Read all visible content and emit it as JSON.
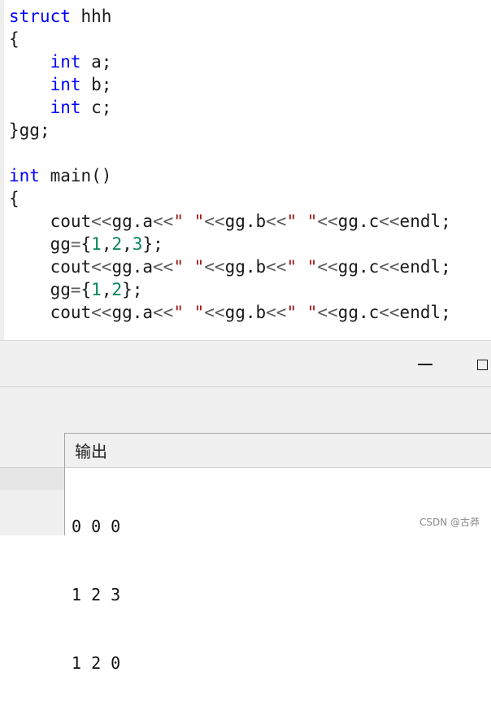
{
  "code": {
    "lines": [
      [
        {
          "t": "struct",
          "c": "kw"
        },
        {
          "t": " hhh"
        }
      ],
      [
        {
          "t": "{"
        }
      ],
      [
        {
          "t": "    "
        },
        {
          "t": "int",
          "c": "kw"
        },
        {
          "t": " a;"
        }
      ],
      [
        {
          "t": "    "
        },
        {
          "t": "int",
          "c": "kw"
        },
        {
          "t": " b;"
        }
      ],
      [
        {
          "t": "    "
        },
        {
          "t": "int",
          "c": "kw"
        },
        {
          "t": " c;"
        }
      ],
      [
        {
          "t": "}gg;"
        }
      ],
      [
        {
          "t": ""
        }
      ],
      [
        {
          "t": "int",
          "c": "kw"
        },
        {
          "t": " main()"
        }
      ],
      [
        {
          "t": "{"
        }
      ],
      [
        {
          "t": "    cout"
        },
        {
          "t": "<<",
          "c": "op"
        },
        {
          "t": "gg.a"
        },
        {
          "t": "<<",
          "c": "op"
        },
        {
          "t": "\" \"",
          "c": "str"
        },
        {
          "t": "<<",
          "c": "op"
        },
        {
          "t": "gg.b"
        },
        {
          "t": "<<",
          "c": "op"
        },
        {
          "t": "\" \"",
          "c": "str"
        },
        {
          "t": "<<",
          "c": "op"
        },
        {
          "t": "gg.c"
        },
        {
          "t": "<<",
          "c": "op"
        },
        {
          "t": "endl;"
        }
      ],
      [
        {
          "t": "    gg"
        },
        {
          "t": "=",
          "c": "op"
        },
        {
          "t": "{"
        },
        {
          "t": "1",
          "c": "num"
        },
        {
          "t": ","
        },
        {
          "t": "2",
          "c": "num"
        },
        {
          "t": ","
        },
        {
          "t": "3",
          "c": "num"
        },
        {
          "t": "};"
        }
      ],
      [
        {
          "t": "    cout"
        },
        {
          "t": "<<",
          "c": "op"
        },
        {
          "t": "gg.a"
        },
        {
          "t": "<<",
          "c": "op"
        },
        {
          "t": "\" \"",
          "c": "str"
        },
        {
          "t": "<<",
          "c": "op"
        },
        {
          "t": "gg.b"
        },
        {
          "t": "<<",
          "c": "op"
        },
        {
          "t": "\" \"",
          "c": "str"
        },
        {
          "t": "<<",
          "c": "op"
        },
        {
          "t": "gg.c"
        },
        {
          "t": "<<",
          "c": "op"
        },
        {
          "t": "endl;"
        }
      ],
      [
        {
          "t": "    gg"
        },
        {
          "t": "=",
          "c": "op"
        },
        {
          "t": "{"
        },
        {
          "t": "1",
          "c": "num"
        },
        {
          "t": ","
        },
        {
          "t": "2",
          "c": "num"
        },
        {
          "t": "};"
        }
      ],
      [
        {
          "t": "    cout"
        },
        {
          "t": "<<",
          "c": "op"
        },
        {
          "t": "gg.a"
        },
        {
          "t": "<<",
          "c": "op"
        },
        {
          "t": "\" \"",
          "c": "str"
        },
        {
          "t": "<<",
          "c": "op"
        },
        {
          "t": "gg.b"
        },
        {
          "t": "<<",
          "c": "op"
        },
        {
          "t": "\" \"",
          "c": "str"
        },
        {
          "t": "<<",
          "c": "op"
        },
        {
          "t": "gg.c"
        },
        {
          "t": "<<",
          "c": "op"
        },
        {
          "t": "endl;"
        }
      ]
    ]
  },
  "window": {
    "minimize_icon": "minimize-icon",
    "maximize_icon": "maximize-icon"
  },
  "output": {
    "title": "输出",
    "lines": [
      "0 0 0",
      "1 2 3",
      "1 2 0"
    ]
  },
  "watermark": "CSDN @古莽",
  "colors": {
    "keyword": "#0000ff",
    "number": "#098658",
    "string": "#a31515",
    "operator": "#5b5b5b"
  }
}
